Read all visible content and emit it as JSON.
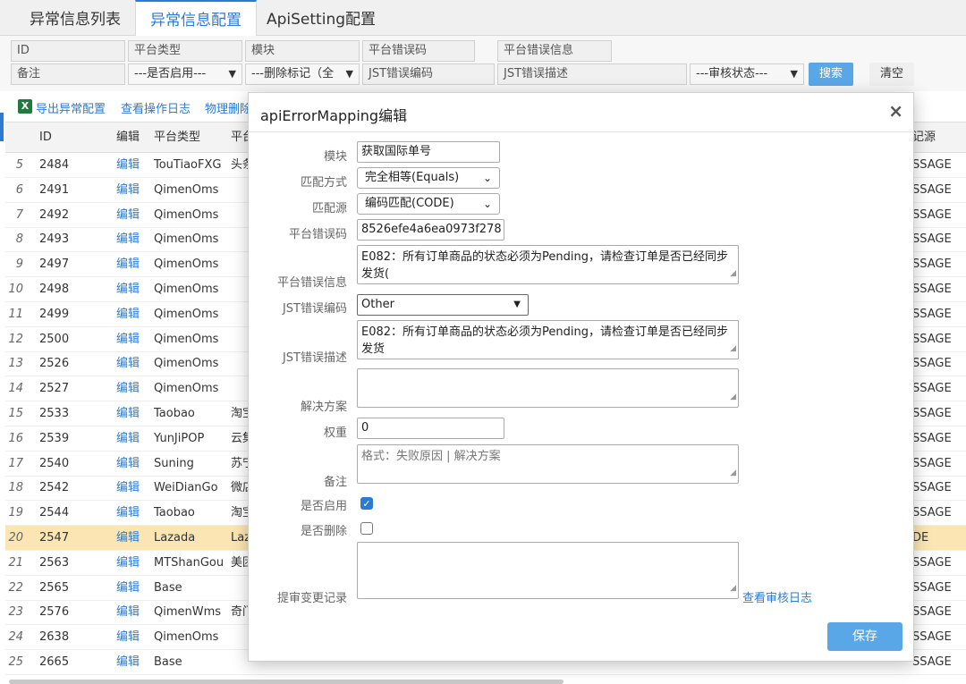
{
  "tabs": [
    "异常信息列表",
    "异常信息配置",
    "ApiSetting配置"
  ],
  "filters": {
    "row1": [
      "ID",
      "平台类型",
      "模块",
      "平台错误码",
      "平台错误信息"
    ],
    "remark": "备注",
    "enabled_select": "---是否启用---",
    "deleted_select": "---删除标记（全",
    "jst_code_placeholder": "JST错误编码",
    "jst_desc_placeholder": "JST错误描述",
    "audit_select": "---审核状态---",
    "search_label": "搜索",
    "clear_label": "清空"
  },
  "toolbar": {
    "export": "导出异常配置",
    "log": "查看操作日志",
    "physical_delete": "物理删除"
  },
  "table": {
    "headers": [
      "ID",
      "编辑",
      "平台类型",
      "平台",
      "记源"
    ],
    "rows": [
      {
        "n": "5",
        "id": "2484",
        "edit": "编辑",
        "platform": "TouTiaoFXG",
        "plat2": "头条",
        "src": "SSAGE"
      },
      {
        "n": "6",
        "id": "2491",
        "edit": "编辑",
        "platform": "QimenOms",
        "plat2": "",
        "src": "SSAGE"
      },
      {
        "n": "7",
        "id": "2492",
        "edit": "编辑",
        "platform": "QimenOms",
        "plat2": "",
        "src": "SSAGE"
      },
      {
        "n": "8",
        "id": "2493",
        "edit": "编辑",
        "platform": "QimenOms",
        "plat2": "",
        "src": "SSAGE"
      },
      {
        "n": "9",
        "id": "2497",
        "edit": "编辑",
        "platform": "QimenOms",
        "plat2": "",
        "src": "SSAGE"
      },
      {
        "n": "10",
        "id": "2498",
        "edit": "编辑",
        "platform": "QimenOms",
        "plat2": "",
        "src": "SSAGE"
      },
      {
        "n": "11",
        "id": "2499",
        "edit": "编辑",
        "platform": "QimenOms",
        "plat2": "",
        "src": "SSAGE"
      },
      {
        "n": "12",
        "id": "2500",
        "edit": "编辑",
        "platform": "QimenOms",
        "plat2": "",
        "src": "SSAGE"
      },
      {
        "n": "13",
        "id": "2526",
        "edit": "编辑",
        "platform": "QimenOms",
        "plat2": "",
        "src": "SSAGE"
      },
      {
        "n": "14",
        "id": "2527",
        "edit": "编辑",
        "platform": "QimenOms",
        "plat2": "",
        "src": "SSAGE"
      },
      {
        "n": "15",
        "id": "2533",
        "edit": "编辑",
        "platform": "Taobao",
        "plat2": "淘宝",
        "src": "SSAGE"
      },
      {
        "n": "16",
        "id": "2539",
        "edit": "编辑",
        "platform": "YunJiPOP",
        "plat2": "云集",
        "src": "SSAGE"
      },
      {
        "n": "17",
        "id": "2540",
        "edit": "编辑",
        "platform": "Suning",
        "plat2": "苏宁",
        "src": "SSAGE"
      },
      {
        "n": "18",
        "id": "2542",
        "edit": "编辑",
        "platform": "WeiDianGo",
        "plat2": "微店",
        "src": "SSAGE"
      },
      {
        "n": "19",
        "id": "2544",
        "edit": "编辑",
        "platform": "Taobao",
        "plat2": "淘宝",
        "src": "SSAGE"
      },
      {
        "n": "20",
        "id": "2547",
        "edit": "编辑",
        "platform": "Lazada",
        "plat2": "Laz",
        "src": "DE"
      },
      {
        "n": "21",
        "id": "2563",
        "edit": "编辑",
        "platform": "MTShanGou",
        "plat2": "美团",
        "src": "SSAGE"
      },
      {
        "n": "22",
        "id": "2565",
        "edit": "编辑",
        "platform": "Base",
        "plat2": "",
        "src": "SSAGE"
      },
      {
        "n": "23",
        "id": "2576",
        "edit": "编辑",
        "platform": "QimenWms",
        "plat2": "奇门",
        "src": "SSAGE"
      },
      {
        "n": "24",
        "id": "2638",
        "edit": "编辑",
        "platform": "QimenOms",
        "plat2": "",
        "src": "SSAGE"
      },
      {
        "n": "25",
        "id": "2665",
        "edit": "编辑",
        "platform": "Base",
        "plat2": "",
        "src": "SSAGE"
      }
    ]
  },
  "modal": {
    "title": "apiErrorMapping编辑",
    "close": "×",
    "labels": {
      "module": "模块",
      "match_mode": "匹配方式",
      "match_source": "匹配源",
      "platform_code": "平台错误码",
      "platform_msg": "平台错误信息",
      "jst_code": "JST错误编码",
      "jst_desc": "JST错误描述",
      "solution": "解决方案",
      "weight": "权重",
      "remark": "备注",
      "enabled": "是否启用",
      "deleted": "是否删除",
      "audit_record": "提审变更记录"
    },
    "values": {
      "module": "获取国际单号",
      "match_mode": "完全相等(Equals)",
      "match_source": "编码匹配(CODE)",
      "platform_code": "8526efe4a6ea0973f278",
      "platform_msg": "E082：所有订单商品的状态必须为Pending，请检查订单是否已经同步发货(",
      "jst_code": "Other",
      "jst_desc": "E082：所有订单商品的状态必须为Pending，请检查订单是否已经同步发货",
      "solution": "",
      "weight": "0",
      "remark_placeholder": "格式：失败原因 | 解决方案",
      "audit_record": ""
    },
    "audit_link": "查看审核日志",
    "save": "保存"
  }
}
